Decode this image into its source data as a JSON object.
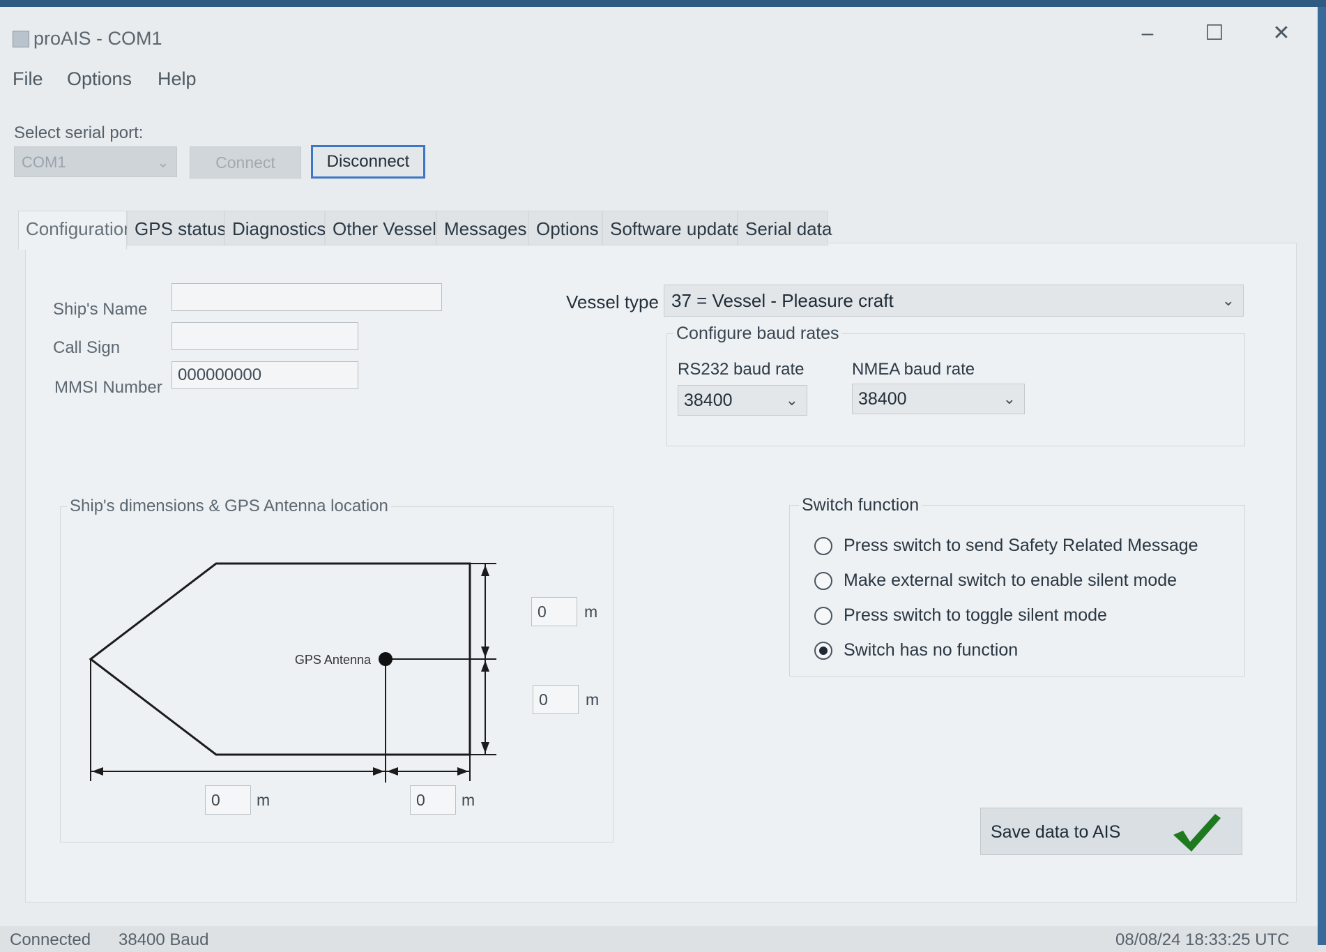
{
  "window": {
    "title": "proAIS - COM1",
    "controls": {
      "minimize": "–",
      "maximize": "☐",
      "close": "✕"
    }
  },
  "menu": [
    "File",
    "Options",
    "Help"
  ],
  "serial": {
    "label": "Select serial port:",
    "port": "COM1",
    "connect_label": "Connect",
    "disconnect_label": "Disconnect"
  },
  "tabs": [
    {
      "label": "Configuration",
      "active": true
    },
    {
      "label": "GPS status"
    },
    {
      "label": "Diagnostics"
    },
    {
      "label": "Other Vessels"
    },
    {
      "label": "Messages"
    },
    {
      "label": "Options"
    },
    {
      "label": "Software update"
    },
    {
      "label": "Serial data"
    }
  ],
  "ship": {
    "name_label": "Ship's Name",
    "name_value": "",
    "callsign_label": "Call Sign",
    "callsign_value": "",
    "mmsi_label": "MMSI Number",
    "mmsi_value": "000000000"
  },
  "vessel": {
    "label": "Vessel type",
    "value": "37 =  Vessel - Pleasure craft"
  },
  "baud": {
    "group_title": "Configure baud rates",
    "rs232_label": "RS232 baud rate",
    "rs232_value": "38400",
    "nmea_label": "NMEA baud rate",
    "nmea_value": "38400"
  },
  "dimensions": {
    "group_title": "Ship's dimensions & GPS Antenna location",
    "antenna_label": "GPS Antenna",
    "unit": "m",
    "top_value": "0",
    "bottom_value": "0",
    "left_value": "0",
    "right_value": "0"
  },
  "switch": {
    "group_title": "Switch function",
    "options": [
      {
        "label": "Press switch to send Safety Related Message",
        "checked": false
      },
      {
        "label": "Make external switch to enable silent mode",
        "checked": false
      },
      {
        "label": "Press switch to toggle silent mode",
        "checked": false
      },
      {
        "label": "Switch has no function",
        "checked": true
      }
    ]
  },
  "save": {
    "label": "Save data to AIS",
    "icon": "checkmark-icon",
    "icon_color": "#1f7a1f"
  },
  "status": {
    "connection": "Connected",
    "baud": "38400 Baud",
    "datetime": "08/08/24  18:33:25 UTC"
  }
}
